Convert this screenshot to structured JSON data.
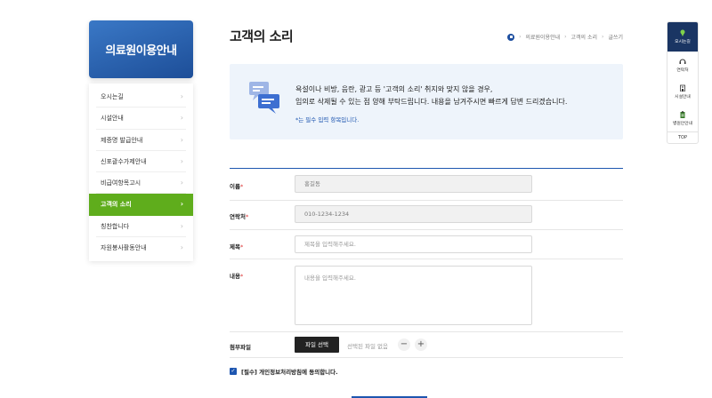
{
  "sidebar": {
    "title": "의료원이용안내",
    "items": [
      {
        "label": "오시는길"
      },
      {
        "label": "시설안내"
      },
      {
        "label": "제증명 발급안내"
      },
      {
        "label": "신포괄수가제안내"
      },
      {
        "label": "비급여항목고시"
      },
      {
        "label": "고객의 소리"
      },
      {
        "label": "칭찬합니다"
      },
      {
        "label": "자원봉사활동안내"
      }
    ]
  },
  "page": {
    "title": "고객의 소리",
    "breadcrumb": [
      "의료원이용안내",
      "고객의 소리",
      "글쓰기"
    ]
  },
  "notice": {
    "line1": "욕설이나 비방, 음란, 광고 등 '고객의 소리' 취지와 맞지 않을 경우,",
    "line2": "임의로 삭제될 수 있는 점 양해 부탁드립니다. 내용을 남겨주시면 빠르게 답변 드리겠습니다.",
    "required_note": "*는 필수 입력 항목입니다."
  },
  "form": {
    "name_label": "이름",
    "name_value": "홍길동",
    "phone_label": "연락처",
    "phone_value": "010-1234-1234",
    "subject_label": "제목",
    "subject_placeholder": "제목을 입력해주세요.",
    "content_label": "내용",
    "content_placeholder": "내용을 입력해주세요.",
    "file_label": "첨부파일",
    "file_button": "파일 선택",
    "file_status": "선택된 파일 없음",
    "minus": "−",
    "plus": "+",
    "required_mark": "*",
    "agree_label": "[필수] 개인정보처리방침에 동의합니다."
  },
  "quick_menu": {
    "items": [
      {
        "label": "오시는길",
        "icon": "pin-icon"
      },
      {
        "label": "연락처",
        "icon": "headset-icon"
      },
      {
        "label": "시설안내",
        "icon": "building-icon"
      },
      {
        "label": "병원안안내",
        "icon": "clipboard-icon"
      }
    ],
    "top": "TOP"
  },
  "colors": {
    "primary": "#1e56b0",
    "sidebar_head": "#2a62b0",
    "active": "#5fad1c",
    "quick_first": "#1a3563"
  }
}
